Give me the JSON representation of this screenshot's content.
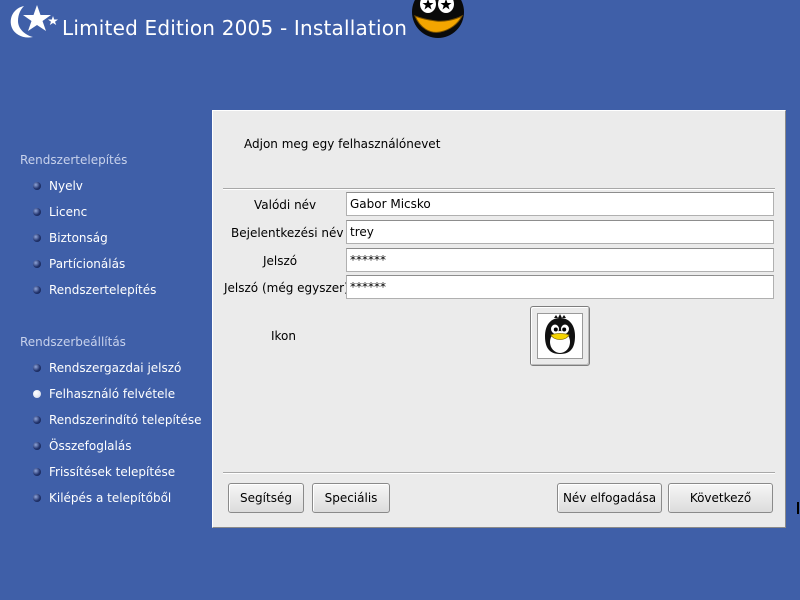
{
  "header": {
    "title": "Limited Edition 2005 - Installation",
    "logo_icon": "star-logo-icon",
    "mascot_icon": "penguin-mascot-icon"
  },
  "sidebar": {
    "sections": [
      {
        "title": "Rendszertelepítés",
        "items": [
          {
            "label": "Nyelv",
            "active": false
          },
          {
            "label": "Licenc",
            "active": false
          },
          {
            "label": "Biztonság",
            "active": false
          },
          {
            "label": "Partícionálás",
            "active": false
          },
          {
            "label": "Rendszertelepítés",
            "active": false
          }
        ]
      },
      {
        "title": "Rendszerbeállítás",
        "items": [
          {
            "label": "Rendszergazdai jelszó",
            "active": false
          },
          {
            "label": "Felhasználó felvétele",
            "active": true
          },
          {
            "label": "Rendszerindító telepítése",
            "active": false
          },
          {
            "label": "Összefoglalás",
            "active": false
          },
          {
            "label": "Frissítések telepítése",
            "active": false
          },
          {
            "label": "Kilépés a telepítőből",
            "active": false
          }
        ]
      }
    ]
  },
  "dialog": {
    "prompt": "Adjon meg egy felhasználónevet",
    "fields": {
      "real_name": {
        "label": "Valódi név",
        "value": "Gabor Micsko"
      },
      "login": {
        "label": "Bejelentkezési név",
        "value": "trey"
      },
      "password": {
        "label": "Jelszó",
        "value": "******"
      },
      "password_again": {
        "label": "Jelszó (még egyszer)",
        "value": "******"
      }
    },
    "icon_label": "Ikon",
    "user_icon": "penguin-avatar-icon",
    "buttons": {
      "help": "Segítség",
      "advanced": "Speciális",
      "accept_name": "Név elfogadása",
      "next": "Következő"
    }
  },
  "colors": {
    "background": "#3f5fa8",
    "panel": "#ebebeb",
    "section_title": "#c8d2ec"
  }
}
